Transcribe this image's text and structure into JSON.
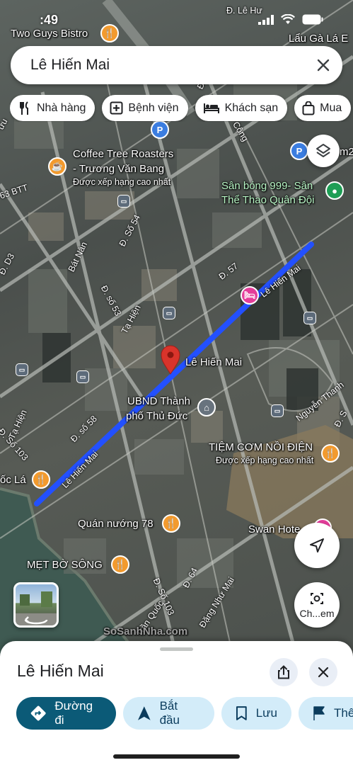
{
  "status_bar": {
    "time": ":49"
  },
  "search": {
    "query": "Lê Hiến Mai"
  },
  "chips": [
    {
      "label": "Nhà hàng",
      "icon": "fork-knife-icon"
    },
    {
      "label": "Bệnh viện",
      "icon": "hospital-icon"
    },
    {
      "label": "Khách sạn",
      "icon": "bed-icon"
    },
    {
      "label": "Mua",
      "icon": "shopping-bag-icon"
    }
  ],
  "map": {
    "places": {
      "two_guys": "Two Guys Bistro",
      "lau_ga": "Lẩu Gà Lá E",
      "coffee_tree_1": "Coffee Tree Roasters",
      "coffee_tree_2": "- Trương Văn Bang",
      "coffee_tree_rating": "Được xếp hạng cao nhất",
      "san_bong_1": "Sân bóng 999- Sân",
      "san_bong_2": "Thể Thao Quân Đội",
      "pin_label": "Lê Hiến Mai",
      "ubnd_1": "UBND Thành",
      "ubnd_2": "phố Thủ Đức",
      "tiem_com": "TIỆM CƠM NỒI ĐIỆN",
      "tiem_com_rating": "Được xếp hạng cao nhất",
      "quan_nuong": "Quán nướng 78",
      "swan": "Swan Hote",
      "met_bo_song": "MẸT BỜ SÔNG",
      "oc_la": "ốc Lá",
      "m2": "m2"
    },
    "streets": {
      "le_hien_mai_a": "Lê Hiến Mai",
      "le_hien_mai_b": "Lê Hiến Mai",
      "le_hu": "Đ. Lê Hư",
      "cong": "Cộng",
      "do": "Đồ",
      "bat_nan": "Bát Nàn",
      "d3": "Đ. D3",
      "btt": "63 BTT",
      "so54": "Đ. Số 54",
      "so53": "Đ. số 53",
      "ta_hien_a": "Tạ Hiện",
      "ta_hien_b": "Tạ Hiện",
      "d57": "Đ. 57",
      "so58": "Đ. số 58",
      "so103_a": "Đ. Số 103",
      "so103_b": "Đ. Số 103",
      "d64": "Đ. 64",
      "dang_nhu_mai": "Đặng Như Mai",
      "tran_quoc": "Trần Quốc",
      "nguyen_thanh": "Nguyễn Thanh",
      "d_s": "Đ. S",
      "luu": "ưu"
    },
    "route_color": "#2350ff",
    "pin_color": "#d9342b"
  },
  "fabs": {
    "camera_label": "Ch...em"
  },
  "watermark": "SoSanhNha.com",
  "sheet": {
    "title": "Lê Hiến Mai",
    "actions": [
      {
        "label": "Đường đi",
        "icon": "directions-icon"
      },
      {
        "label": "Bắt đầu",
        "icon": "navigation-arrow-icon"
      },
      {
        "label": "Lưu",
        "icon": "bookmark-icon"
      },
      {
        "label": "Thê",
        "icon": "flag-icon"
      }
    ]
  },
  "colors": {
    "primary_action": "#0b5a77",
    "chip_bg": "#ffffff",
    "tonal_action": "#d3ecf9"
  }
}
